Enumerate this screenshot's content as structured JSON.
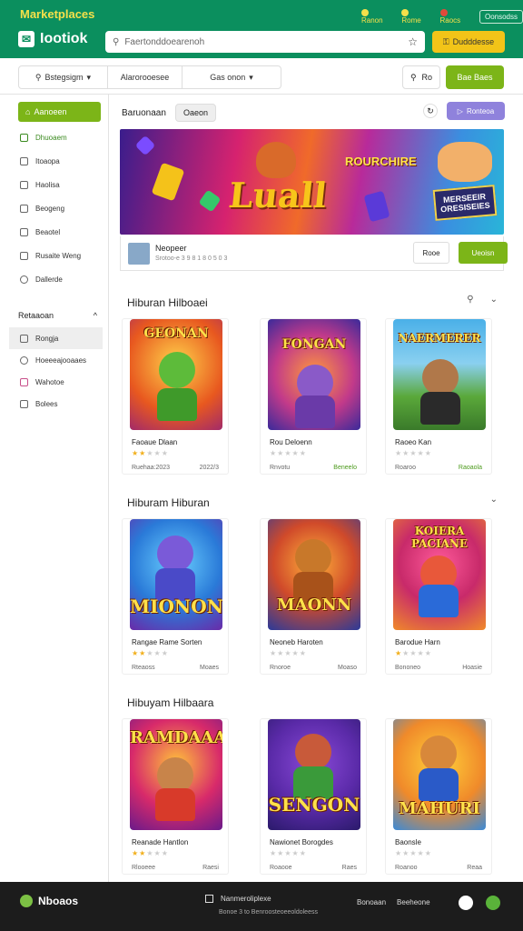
{
  "topbar": {
    "brand_small": "Marketplaces",
    "logo_text": "Iootiok",
    "search_placeholder": "Faertonddoearenoh",
    "button_label": "Dudddesse",
    "links": [
      "Ranon",
      "Rome",
      "Raocs"
    ],
    "pill": "Oonsodss"
  },
  "filters": {
    "items": [
      "Bstegsigm",
      "Alarorooesee",
      "Gas onon"
    ],
    "search_label": "Ro",
    "green_button": "Bae Baes"
  },
  "sidebar": {
    "top_button": "Aanoeen",
    "items": [
      "Dhuoaem",
      "Itoaopa",
      "Haolisa",
      "Beogeng",
      "Beaotel",
      "Rusaite Weng",
      "Dallerde"
    ],
    "section_title": "Retaaoan",
    "sub_items": [
      "Rongja",
      "Hoeeeajooaaes",
      "Wahotoe",
      "Bolees"
    ]
  },
  "main": {
    "header_title": "Baruonaan",
    "header_chip": "Oaeon",
    "header_purple": "Ronteoa",
    "banner": {
      "title": "Luall",
      "subtitle": "ROURCHIRE",
      "sign": "MERSEEIR ORESISEIES",
      "info_title": "Neopeer",
      "info_sub": "Srotoo-e 3 9 8 1 8 0 5 0 3",
      "outline_button": "Rooe",
      "green_button": "Ueoisn"
    },
    "sections": [
      {
        "title": "Hiburan Hilboaei",
        "cards": [
          {
            "art": "GEONAN",
            "name": "Faoaue Dlaan",
            "meta": "Ruehaa:2023",
            "meta2": "2022/3",
            "meta2_green": false
          },
          {
            "art": "FONGAN",
            "name": "Rou Deloenn",
            "meta": "Rnvotu",
            "meta2": "Beneelo",
            "meta2_green": true
          },
          {
            "art": "NAERMERER",
            "name": "Raoeo Kan",
            "meta": "Roaroo",
            "meta2": "Raoaola",
            "meta2_green": true
          }
        ]
      },
      {
        "title": "Hiburam Hiburan",
        "cards": [
          {
            "art": "MIONON",
            "name": "Rangae Rame Sorten",
            "meta": "Rteaoss",
            "meta2": "Moaes",
            "meta2_green": false
          },
          {
            "art": "MAONN",
            "name": "Neoneb Haroten",
            "meta": "Rnoroe",
            "meta2": "Moaso",
            "meta2_green": false
          },
          {
            "art": "KOIERA PACIANE",
            "name": "Barodue Harn",
            "meta": "Bononeo",
            "meta2": "Hoasie",
            "meta2_green": false
          }
        ]
      },
      {
        "title": "Hibuyam Hilbaara",
        "cards": [
          {
            "art": "RAMDAAA",
            "name": "Reanade Hantlon",
            "meta": "Rlooeee",
            "meta2": "Raesi",
            "meta2_green": false
          },
          {
            "art": "SENGON",
            "name": "Nawionet Borogdes",
            "meta": "Roaooe",
            "meta2": "Raes",
            "meta2_green": false
          },
          {
            "art": "MAHURI",
            "name": "Baonsle",
            "meta": "Roanoo",
            "meta2": "Reaa",
            "meta2_green": false
          }
        ]
      }
    ]
  },
  "footer": {
    "logo": "Nboaos",
    "middle_title": "Nanmeroliplexe",
    "middle_sub": "Bonoe 3 to Benroosteoeeoldoleess",
    "links": [
      "Bonoaan",
      "Beeheone"
    ]
  },
  "colors": {
    "green": "#0b8f5e",
    "accent": "#7cb518",
    "yellow": "#f2c418",
    "purple": "#8f82dc"
  }
}
